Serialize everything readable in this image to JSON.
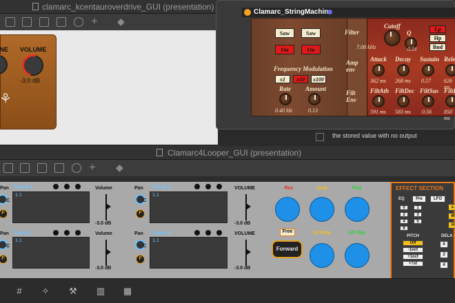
{
  "windows": {
    "overdrive": {
      "title": "clamarc_kcentauroverdrive_GUI (presentation)",
      "labels": {
        "gain_partial": "INE",
        "volume": "VOLUME"
      },
      "volume_value": "-3.0 dB"
    },
    "stringmachine": {
      "title": "Clamarc_StringMachine",
      "filter": {
        "section": "Filter",
        "saw1": "Saw",
        "saw2": "Saw",
        "on1": "On",
        "on2": "On",
        "cutoff_label": "Cutoff",
        "cutoff_value": "7.08 kHz",
        "q_label": "Q",
        "q_value": "0.01",
        "modes": [
          "Lp",
          "Hp",
          "Bnd"
        ]
      },
      "freq_mod": {
        "title": "Frequency Modulation",
        "buttons": [
          "x1",
          "x10",
          "x100"
        ],
        "rate_label": "Rate",
        "rate_value": "0.40 Hz",
        "amount_label": "Amount",
        "amount_value": "0.13"
      },
      "amp_env": {
        "section_line1": "Amp",
        "section_line2": "env",
        "params": [
          {
            "label": "Attack",
            "value": "362 ms"
          },
          {
            "label": "Decay",
            "value": "268 ms"
          },
          {
            "label": "Sustain",
            "value": "0.57"
          },
          {
            "label": "Release",
            "value": "626 ms"
          }
        ]
      },
      "filt_env": {
        "section_line1": "Filt",
        "section_line2": "Env",
        "params": [
          {
            "label": "FiltAth",
            "value": "591 ms"
          },
          {
            "label": "FiltDec",
            "value": "583 ms"
          },
          {
            "label": "FiltSus",
            "value": "0.56"
          },
          {
            "label": "FiltRel",
            "value": "850 ms"
          }
        ]
      }
    },
    "status": {
      "message": "the stored value with no output"
    },
    "looper": {
      "title": "Clamarc4Looper_GUI (presentation)",
      "tracks": [
        {
          "name": "Track 1",
          "clip": "1.1",
          "pan": "Pan",
          "volume": "Volume",
          "vol_value": "-3.0 dB"
        },
        {
          "name": "Track 2",
          "clip": "1.1",
          "pan": "Pan",
          "volume": "VOLUME",
          "vol_value": "-3.0 dB"
        },
        {
          "name": "Track 3",
          "clip": "1.1",
          "pan": "Pan",
          "volume": "Volume",
          "vol_value": "-3.0 dB"
        },
        {
          "name": "Track 4",
          "clip": "1.1",
          "pan": "Pan",
          "volume": "VOLUME",
          "vol_value": "-3.0 dB"
        }
      ],
      "pan_knob_letter": "C",
      "f_letter": "F",
      "transport": {
        "rec": "Rec",
        "stop": "Stop",
        "play": "Play",
        "free": "Free",
        "all_stop": "All Stop",
        "all_play": "All Play",
        "forward": "Forward"
      },
      "effects": {
        "title": "EFFECT SECTION",
        "eq": "EQ",
        "pre": "Pre",
        "lfo": "LFO",
        "eq_rows": [
          [
            "0",
            "1"
          ],
          [
            "2",
            "3"
          ],
          [
            "4",
            "5"
          ],
          [
            "6"
          ]
        ],
        "right_partial": [
          "L",
          "M",
          "H"
        ],
        "pitch": "PITCH",
        "pitch_buttons": [
          "Off",
          "-1oct",
          "+1oct",
          "+7st"
        ],
        "delay_partial": "DELA",
        "delay_buttons": [
          "0",
          "2",
          "4"
        ]
      }
    }
  },
  "colors": {
    "accent_blue": "#1e90e8",
    "rec_red": "#e83020",
    "stop_yellow": "#f0c020",
    "play_green": "#30d040",
    "effect_orange": "#e8781c"
  }
}
